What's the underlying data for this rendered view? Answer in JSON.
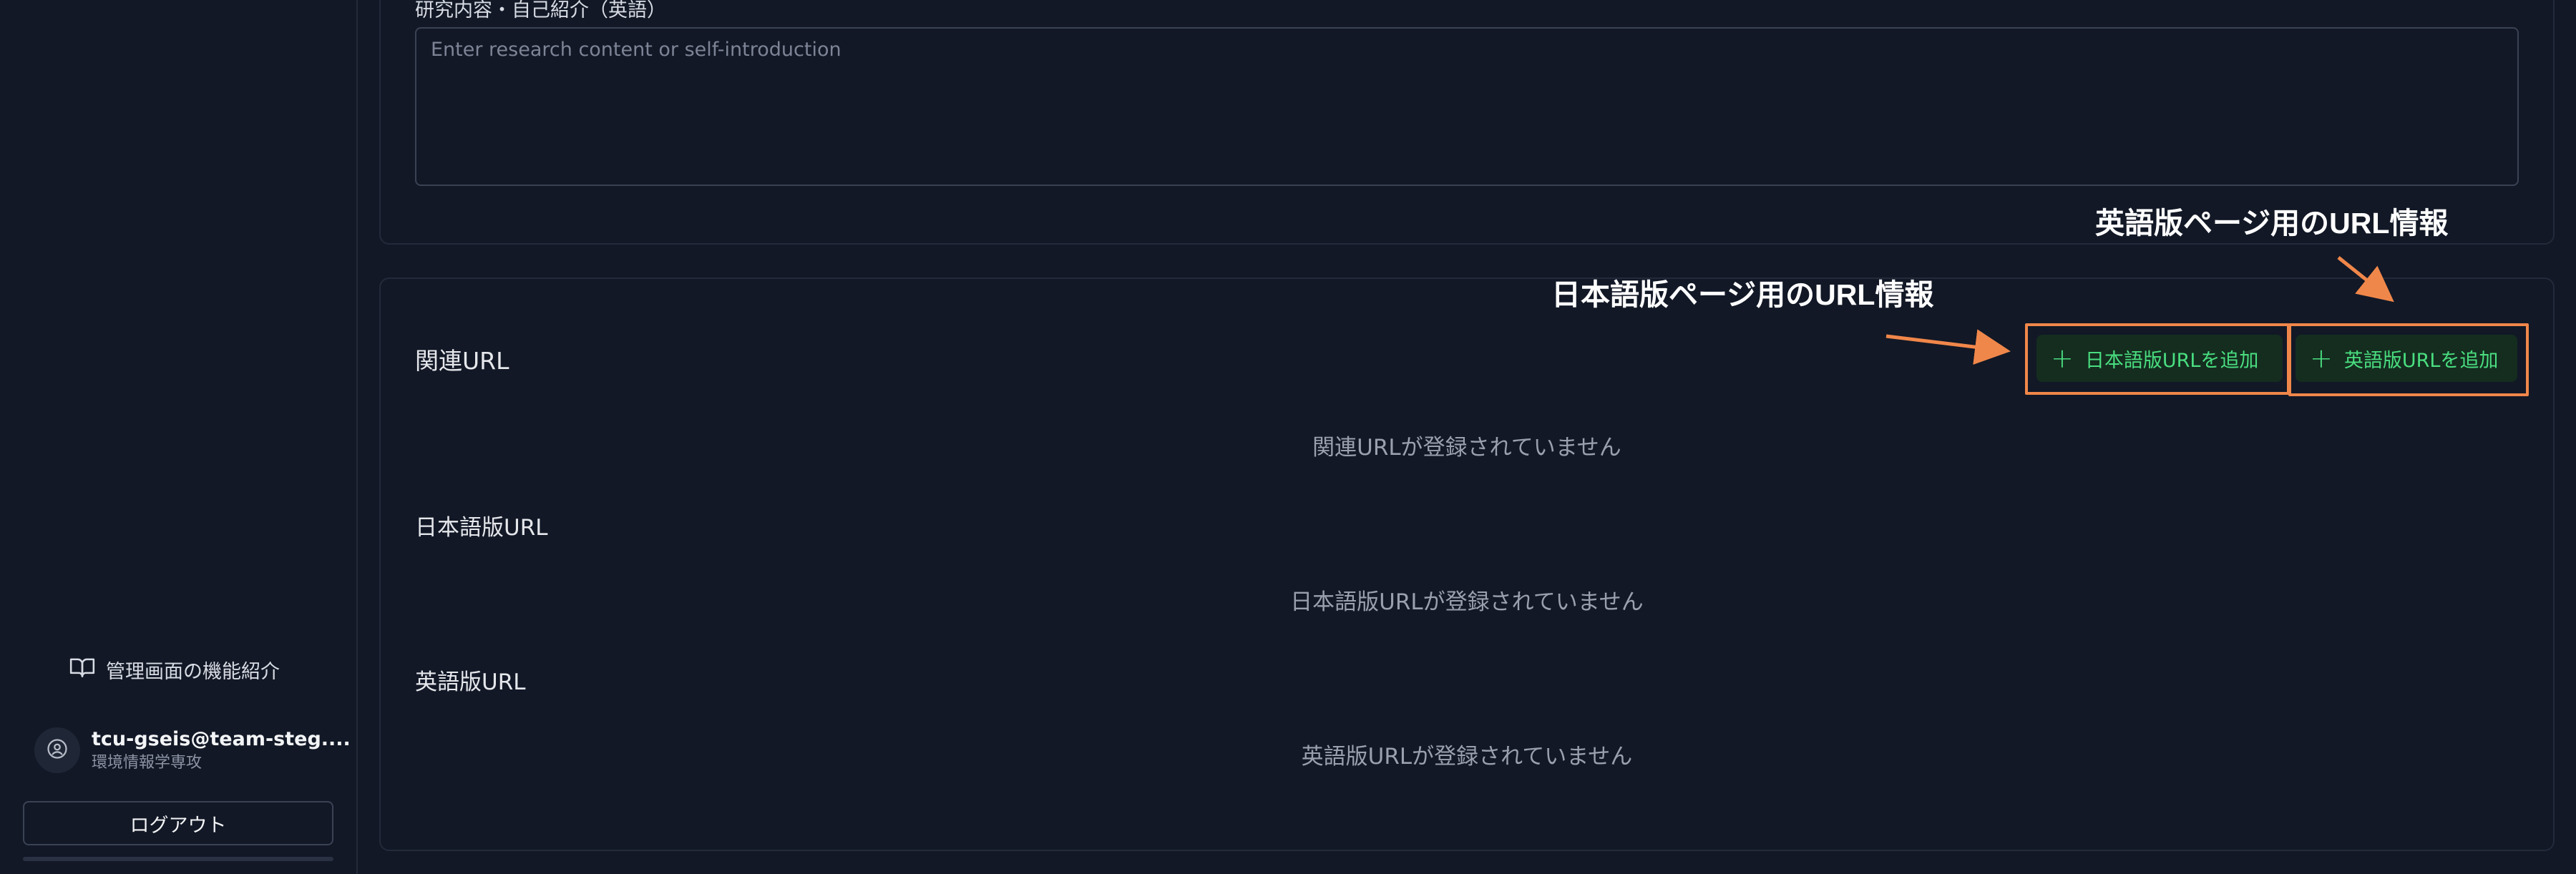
{
  "sidebar": {
    "guide_label": "管理画面の機能紹介",
    "user_email": "tcu-gseis@team-steg....",
    "user_department": "環境情報学専攻",
    "logout_label": "ログアウト"
  },
  "profile": {
    "research_label_en": "研究内容・自己紹介（英語）",
    "research_placeholder_en": "Enter research content or self-introduction"
  },
  "related_urls": {
    "title": "関連URL",
    "empty_message": "関連URLが登録されていません",
    "add_ja_label": "日本語版URLを追加",
    "add_en_label": "英語版URLを追加",
    "ja_section_title": "日本語版URL",
    "ja_empty_message": "日本語版URLが登録されていません",
    "en_section_title": "英語版URL",
    "en_empty_message": "英語版URLが登録されていません"
  },
  "annotations": {
    "ja_note": "日本語版ページ用のURL情報",
    "en_note": "英語版ページ用のURL情報",
    "highlight_color": "#f0874a"
  },
  "colors": {
    "background": "#121826",
    "accent_green": "#4ade80",
    "button_bg": "#142d1f"
  }
}
